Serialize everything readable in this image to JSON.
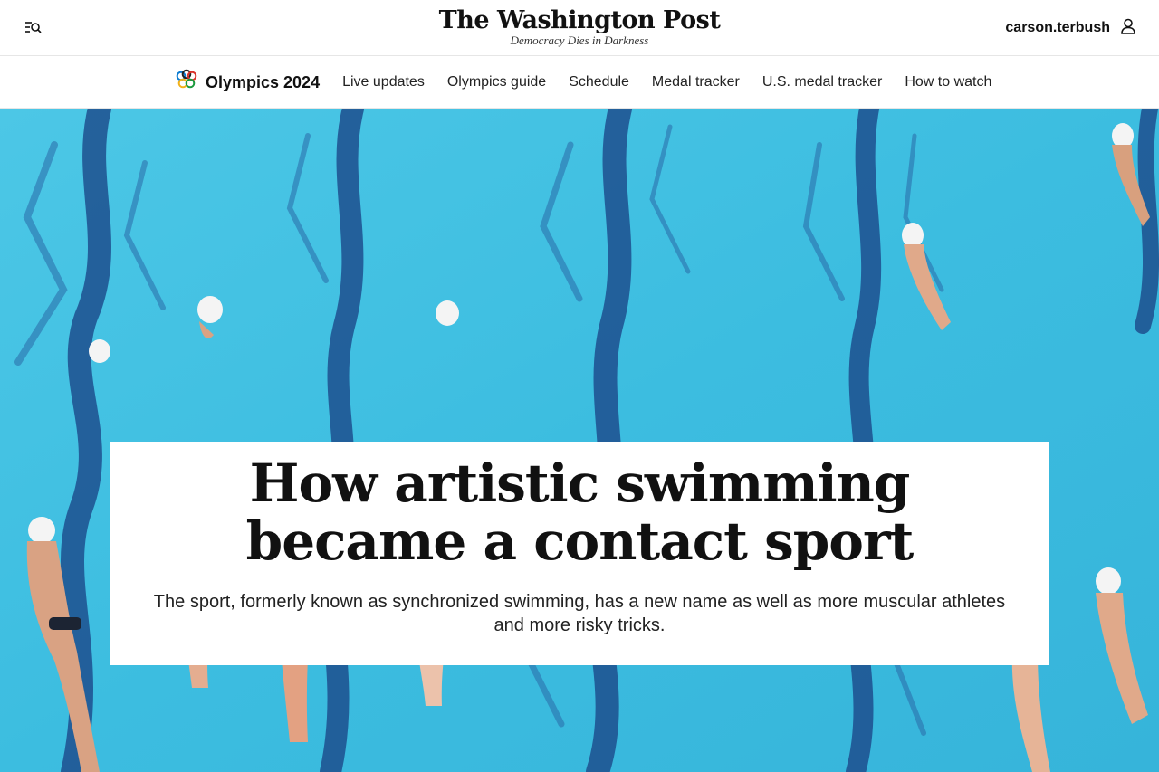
{
  "header": {
    "brand_name": "The Washington Post",
    "brand_tagline": "Democracy Dies in Darkness",
    "menu_icon": "menu-search-icon",
    "user_name": "carson.terbush",
    "user_icon": "user-icon"
  },
  "section_nav": {
    "section_icon": "olympic-rings-icon",
    "section_title": "Olympics 2024",
    "links": [
      "Live updates",
      "Olympics guide",
      "Schedule",
      "Medal tracker",
      "U.S. medal tracker",
      "How to watch"
    ]
  },
  "hero": {
    "headline": "How artistic swimming became a contact sport",
    "dek": "The sport, formerly known as synchronized swimming, has a new name as well as more muscular athletes and more risky tricks."
  },
  "colors": {
    "pool_water": "#40c3e2",
    "lane_lines": "#1d4f8e",
    "card_background": "#ffffff",
    "text": "#111111"
  }
}
